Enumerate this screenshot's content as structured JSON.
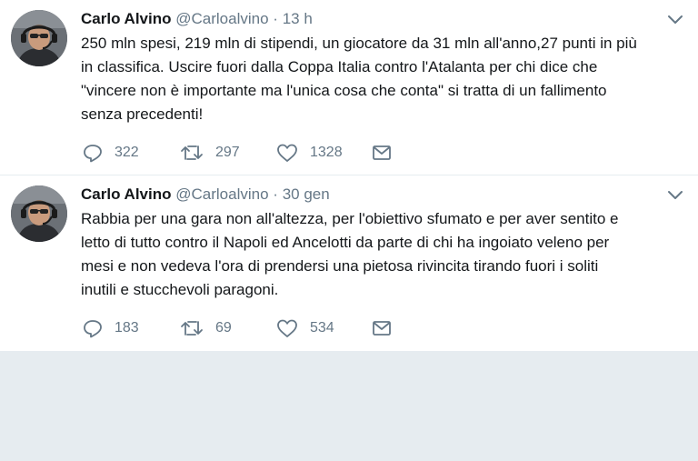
{
  "tweets": [
    {
      "name": "Carlo Alvino",
      "handle": "@Carloalvino",
      "separator": "·",
      "time": "13 h",
      "text": "250 mln spesi, 219 mln di stipendi, un giocatore da 31 mln all'anno,27 punti in più\nin classifica. Uscire fuori dalla Coppa Italia contro l'Atalanta per chi dice che\n\"vincere non è importante ma l'unica cosa che conta\" si tratta di un fallimento\nsenza precedenti!",
      "replies": "322",
      "retweets": "297",
      "likes": "1328"
    },
    {
      "name": "Carlo Alvino",
      "handle": "@Carloalvino",
      "separator": "·",
      "time": "30 gen",
      "text": "Rabbia per una gara non all'altezza, per l'obiettivo sfumato e per aver sentito e\nletto di tutto contro il Napoli ed Ancelotti da parte di chi ha ingoiato veleno per\nmesi e non vedeva l'ora di prendersi una pietosa rivincita tirando fuori i soliti\ninutili e stucchevoli paragoni.",
      "replies": "183",
      "retweets": "69",
      "likes": "534"
    }
  ],
  "icons": {
    "reply": "reply-icon",
    "retweet": "retweet-icon",
    "like": "heart-icon",
    "dm": "envelope-icon",
    "more": "chevron-down-icon"
  },
  "colors": {
    "text": "#14171a",
    "muted": "#657786",
    "divider": "#e6ecf0"
  }
}
